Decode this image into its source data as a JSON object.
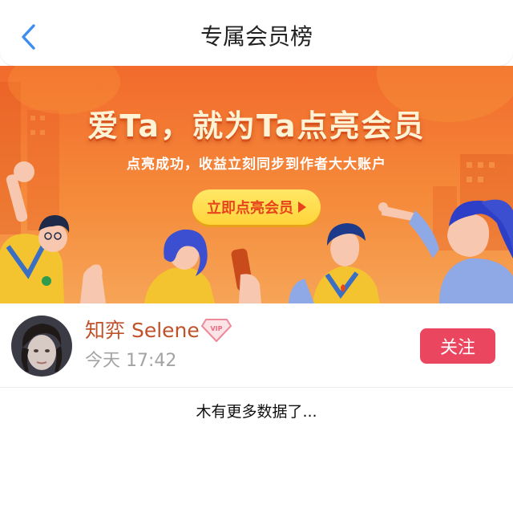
{
  "nav": {
    "title": "专属会员榜"
  },
  "banner": {
    "headline": "爱Ta，就为Ta点亮会员",
    "subtitle": "点亮成功，收益立刻同步到作者大大账户",
    "cta_label": "立即点亮会员"
  },
  "member": {
    "name": "知弈 Selene",
    "badge": "VIP",
    "time": "今天 17:42",
    "follow_label": "关注"
  },
  "list": {
    "end_text": "木有更多数据了..."
  },
  "colors": {
    "back_icon": "#3d8ef0",
    "banner_orange": "#f26a2c",
    "cta_yellow": "#ffd43a",
    "member_name": "#c0522a",
    "follow_button": "#ea4660",
    "vip_pink": "#ec8a9a"
  },
  "icons": {
    "back": "chevron-left-icon",
    "badge": "vip-diamond-icon",
    "cta": "triangle-right-icon"
  }
}
